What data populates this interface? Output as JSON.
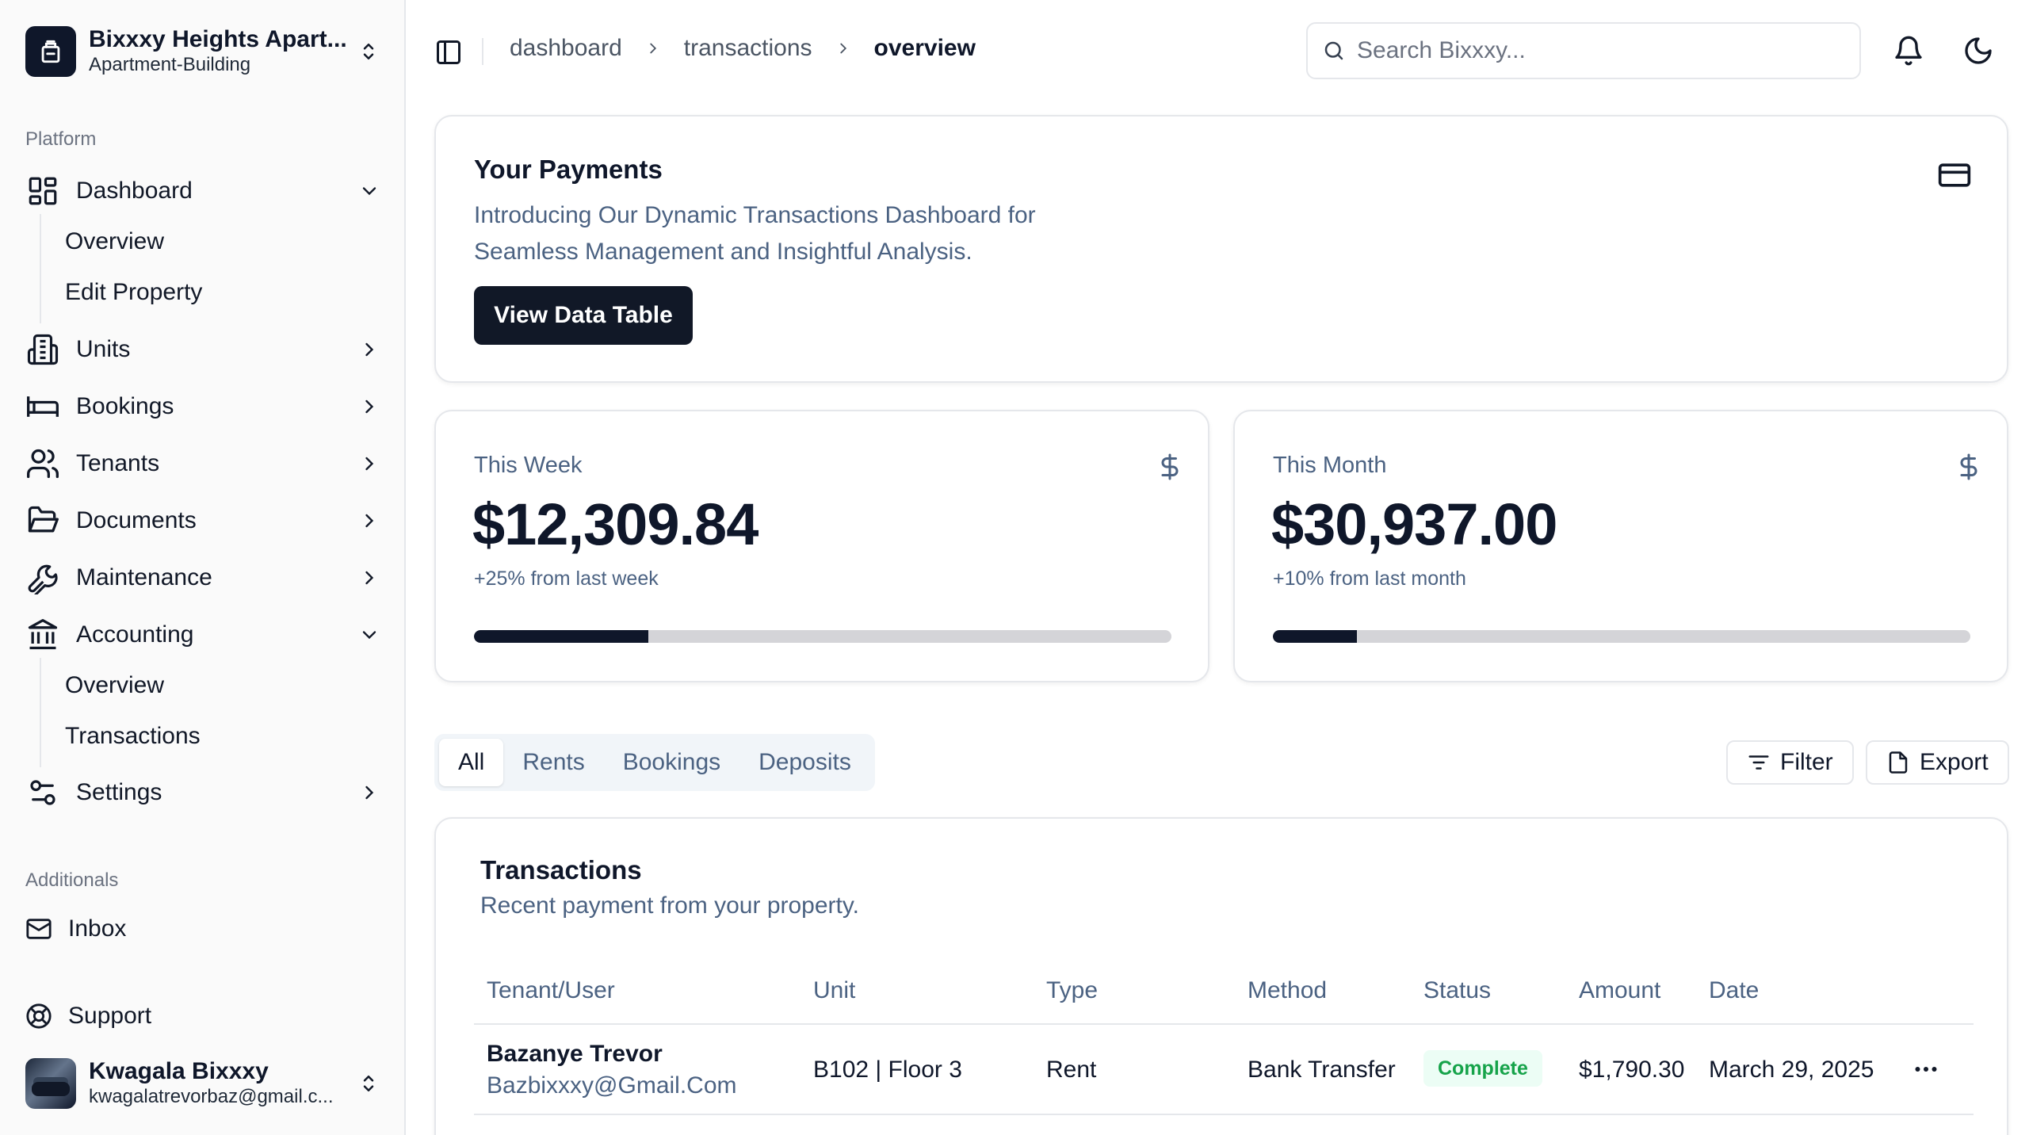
{
  "team": {
    "name": "Bixxxy Heights Apart...",
    "type": "Apartment-Building"
  },
  "sidebar": {
    "platform_label": "Platform",
    "dashboard": {
      "label": "Dashboard",
      "sub": [
        "Overview",
        "Edit Property"
      ]
    },
    "units": "Units",
    "bookings": "Bookings",
    "tenants": "Tenants",
    "documents": "Documents",
    "maintenance": "Maintenance",
    "accounting": {
      "label": "Accounting",
      "sub": [
        "Overview",
        "Transactions"
      ]
    },
    "settings": "Settings",
    "additionals_label": "Additionals",
    "inbox": "Inbox",
    "support": "Support"
  },
  "user": {
    "name": "Kwagala Bixxxy",
    "email": "kwagalatrevorbaz@gmail.c..."
  },
  "breadcrumb": [
    "dashboard",
    "transactions",
    "overview"
  ],
  "search": {
    "placeholder": "Search Bixxxy..."
  },
  "payments": {
    "title": "Your Payments",
    "desc": "Introducing Our Dynamic Transactions Dashboard for Seamless Management and Insightful Analysis.",
    "button": "View Data Table"
  },
  "stats": {
    "week": {
      "label": "This Week",
      "value": "$12,309.84",
      "note": "+25% from last week",
      "progress": 0.25
    },
    "month": {
      "label": "This Month",
      "value": "$30,937.00",
      "note": "+10% from last month",
      "progress": 0.12
    }
  },
  "tabs": [
    "All",
    "Rents",
    "Bookings",
    "Deposits"
  ],
  "actions": {
    "filter": "Filter",
    "export": "Export"
  },
  "transactions": {
    "title": "Transactions",
    "subtitle": "Recent payment from your property.",
    "columns": [
      "Tenant/User",
      "Unit",
      "Type",
      "Method",
      "Status",
      "Amount",
      "Date"
    ],
    "rows": [
      {
        "name": "Bazanye Trevor",
        "email": "Bazbixxxy@Gmail.Com",
        "unit": "B102 | Floor 3",
        "type": "Rent",
        "method": "Bank Transfer",
        "status": "Complete",
        "amount": "$1,790.30",
        "date": "March 29, 2025"
      }
    ]
  },
  "colors": {
    "primary": "#111827",
    "muted": "#4b6282",
    "success": "#16a34a",
    "border": "#e5e7eb"
  }
}
